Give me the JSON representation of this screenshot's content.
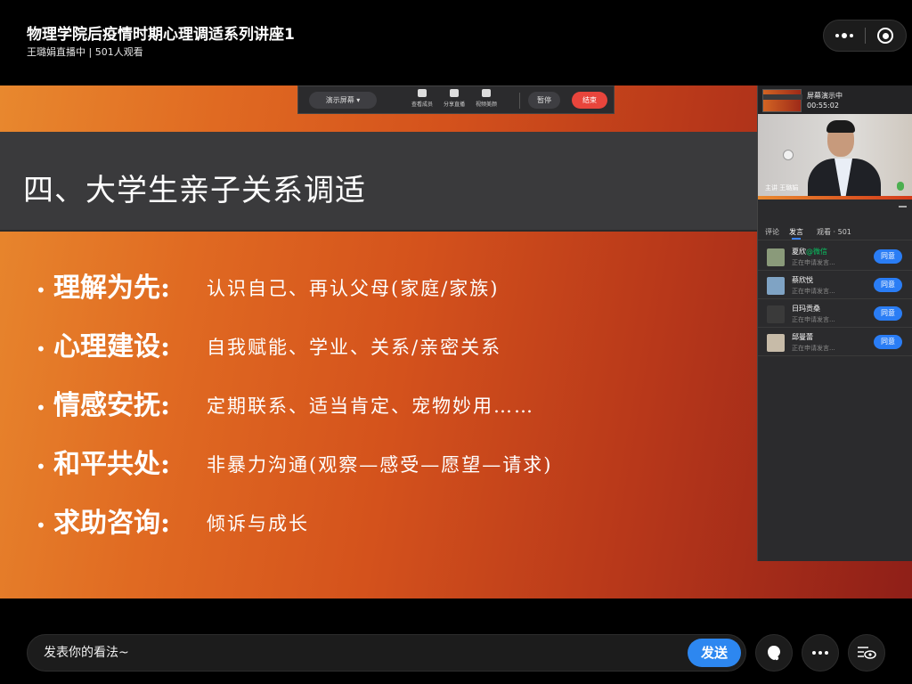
{
  "header": {
    "title": "物理学院后疫情时期心理调适系列讲座1",
    "subtitle": "王璐娟直播中 | 501人观看",
    "more_icon": "more-dots-icon",
    "close_icon": "target-close-icon"
  },
  "slide": {
    "heading": "四、大学生亲子关系调适",
    "bullets": [
      {
        "label": "理解为先:",
        "desc": "认识自己、再认父母(家庭/家族)"
      },
      {
        "label": "心理建设:",
        "desc": "自我赋能、学业、关系/亲密关系"
      },
      {
        "label": "情感安抚:",
        "desc": "定期联系、适当肯定、宠物妙用……"
      },
      {
        "label": "和平共处:",
        "desc": "非暴力沟通(观察—感受—愿望—请求)"
      },
      {
        "label": "求助咨询:",
        "desc": "倾诉与成长"
      }
    ],
    "bullet_char": "•"
  },
  "presenter_toolbar": {
    "screen_select": "演示屏幕 ▾",
    "items": [
      "查看成员",
      "分享直播",
      "视频美颜"
    ],
    "pause": "暂停",
    "end": "结束"
  },
  "side_panel": {
    "status": "屏幕演示中",
    "time": "00:55:02",
    "video_label": "主讲  王璐娟",
    "tabs": [
      "评论",
      "发言",
      "观看 · 501"
    ],
    "active_tab": "发言",
    "requests": [
      {
        "name": "夏欣",
        "via": "@微信",
        "status": "正在申请发言...",
        "action": "同意",
        "avatar_color": "#8a9a7a"
      },
      {
        "name": "蔡欣悦",
        "via": "",
        "status": "正在申请发言...",
        "action": "同意",
        "avatar_color": "#7fa3c4"
      },
      {
        "name": "日玛贡桑",
        "via": "",
        "status": "正在申请发言...",
        "action": "同意",
        "avatar_color": "#3a3a3a"
      },
      {
        "name": "邱曼蕾",
        "via": "",
        "status": "正在申请发言...",
        "action": "同意",
        "avatar_color": "#c7bba8"
      }
    ]
  },
  "bottom": {
    "comment_placeholder": "发表你的看法~",
    "send": "发送",
    "like_icon": "like-icon",
    "more_icon": "more-icon",
    "view_icon": "eye-view-icon"
  }
}
